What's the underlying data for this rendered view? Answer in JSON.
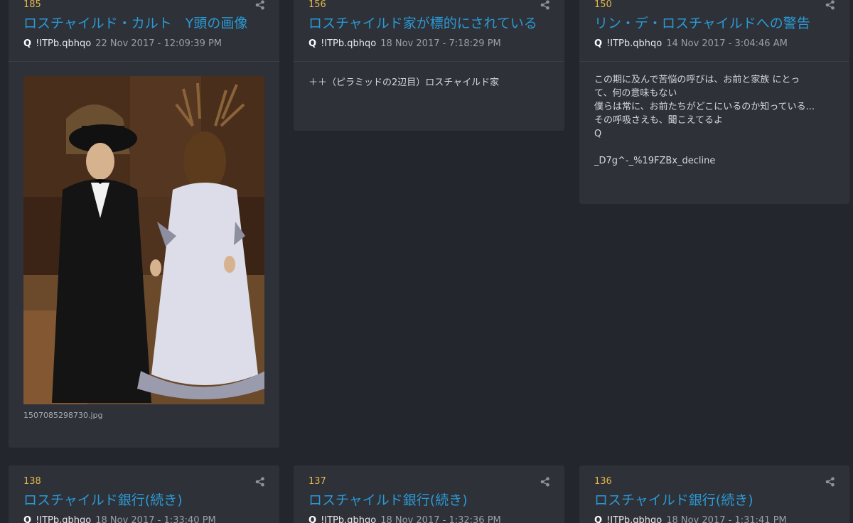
{
  "posts": [
    {
      "number": "185",
      "title": "ロスチャイルド・カルト　Y頭の画像",
      "author": "Q",
      "tripcode": "!ITPb.qbhqo",
      "date": "22 Nov 2017 - 12:09:39 PM",
      "image_filename": "1507085298730.jpg"
    },
    {
      "number": "156",
      "title": "ロスチャイルド家が標的にされている",
      "author": "Q",
      "tripcode": "!ITPb.qbhqo",
      "date": "18 Nov 2017 - 7:18:29 PM",
      "body": [
        "＋＋（ピラミッドの2辺目）ロスチャイルド家"
      ]
    },
    {
      "number": "150",
      "title": "リン・デ・ロスチャイルドへの警告",
      "author": "Q",
      "tripcode": "!ITPb.qbhqo",
      "date": "14 Nov 2017 - 3:04:46 AM",
      "body": [
        "この期に及んで苦悩の呼びは、お前と家族 にとっ",
        "て、何の意味もない",
        "僕らは常に、お前たちがどこにいるのか知っている...",
        "その呼吸さえも、聞こえてるよ",
        "Q",
        "",
        "_D7g^-_%19FZBx_decline"
      ]
    },
    {
      "number": "138",
      "title": "ロスチャイルド銀行(続き)",
      "author": "Q",
      "tripcode": "!ITPb.qbhqo",
      "date": "18 Nov 2017 - 1:33:40 PM"
    },
    {
      "number": "137",
      "title": "ロスチャイルド銀行(続き)",
      "author": "Q",
      "tripcode": "!ITPb.qbhqo",
      "date": "18 Nov 2017 - 1:32:36 PM"
    },
    {
      "number": "136",
      "title": "ロスチャイルド銀行(続き)",
      "author": "Q",
      "tripcode": "!ITPb.qbhqo",
      "date": "18 Nov 2017 - 1:31:41 PM"
    }
  ],
  "icons": {
    "share": "share-icon"
  },
  "colors": {
    "page_bg": "#23262c",
    "card_bg": "#2e3138",
    "post_number": "#e2b64a",
    "title_link": "#2b99d3",
    "date_text": "#9aa0a8"
  }
}
